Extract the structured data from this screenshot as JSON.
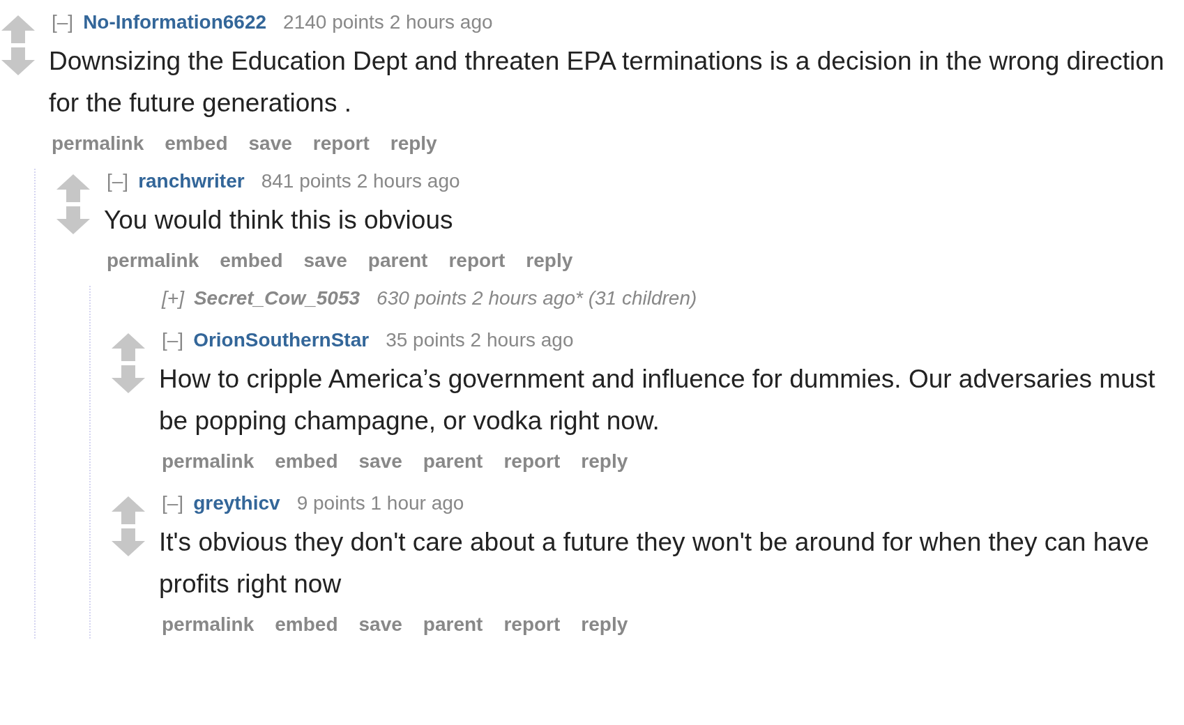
{
  "comments": [
    {
      "collapsed": false,
      "toggle": "[–]",
      "author": "No-Information6622",
      "points": "2140 points",
      "time": "2 hours ago",
      "body": "Downsizing the Education Dept and threaten EPA terminations is a decision in the wrong direction for the future generations .",
      "buttons": [
        "permalink",
        "embed",
        "save",
        "report",
        "reply"
      ],
      "children": [
        {
          "collapsed": false,
          "toggle": "[–]",
          "author": "ranchwriter",
          "points": "841 points",
          "time": "2 hours ago",
          "body": "You would think this is obvious",
          "buttons": [
            "permalink",
            "embed",
            "save",
            "parent",
            "report",
            "reply"
          ],
          "children": [
            {
              "collapsed": true,
              "toggle": "[+]",
              "author": "Secret_Cow_5053",
              "points": "630 points",
              "time": "2 hours ago*",
              "child_count": "(31 children)"
            },
            {
              "collapsed": false,
              "toggle": "[–]",
              "author": "OrionSouthernStar",
              "points": "35 points",
              "time": "2 hours ago",
              "body": "How to cripple America’s government and influence for dummies. Our adversaries must be popping champagne, or vodka right now.",
              "buttons": [
                "permalink",
                "embed",
                "save",
                "parent",
                "report",
                "reply"
              ]
            },
            {
              "collapsed": false,
              "toggle": "[–]",
              "author": "greythicv",
              "points": "9 points",
              "time": "1 hour ago",
              "body": "It's obvious they don't care about a future they won't be around for when they can have profits right now",
              "buttons": [
                "permalink",
                "embed",
                "save",
                "parent",
                "report",
                "reply"
              ]
            }
          ]
        }
      ]
    }
  ]
}
